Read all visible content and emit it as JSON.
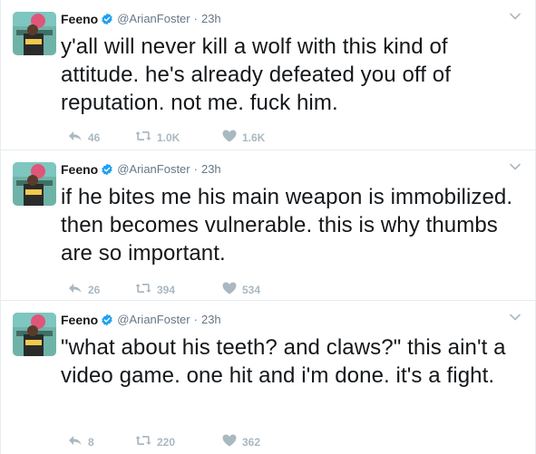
{
  "colors": {
    "verified": "#1da1f2",
    "meta_text": "#657786",
    "action_icons": "#aab8c2",
    "divider": "#e6ecf0"
  },
  "tweets": [
    {
      "name": "Feeno",
      "handle": "@ArianFoster",
      "separator": "·",
      "time": "23h",
      "text": "y'all will never kill a wolf with this kind of attitude. he's already defeated you off of reputation. not me. fuck him.",
      "reply_count": "46",
      "retweet_count": "1.0K",
      "like_count": "1.6K"
    },
    {
      "name": "Feeno",
      "handle": "@ArianFoster",
      "separator": "·",
      "time": "23h",
      "text": "if he bites me his main weapon is immobilized. then becomes vulnerable. this is why thumbs are so important.",
      "reply_count": "26",
      "retweet_count": "394",
      "like_count": "534"
    },
    {
      "name": "Feeno",
      "handle": "@ArianFoster",
      "separator": "·",
      "time": "23h",
      "text": "\"what about his teeth? and claws?\" this ain't a video game. one hit and i'm done. it's a fight.",
      "reply_count": "8",
      "retweet_count": "220",
      "like_count": "362"
    }
  ]
}
